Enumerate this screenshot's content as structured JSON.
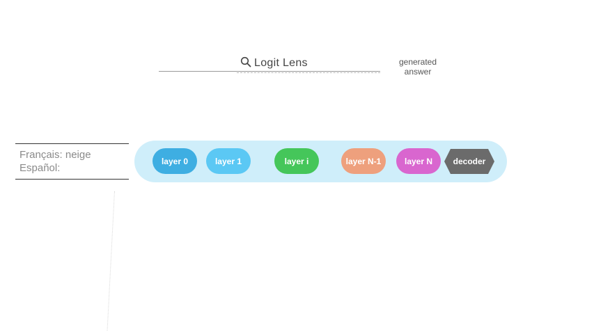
{
  "logit_lens": {
    "title": "Logit Lens",
    "icon": "search-icon"
  },
  "generated_answer": {
    "line1": "generated",
    "line2": "answer"
  },
  "prompt": {
    "line1": "Français: neige",
    "line2": "Español:"
  },
  "layers": [
    {
      "label": "layer 0",
      "color": "#3eaee2"
    },
    {
      "label": "layer 1",
      "color": "#5bc8f4"
    },
    {
      "label": "layer i",
      "color": "#45c65a"
    },
    {
      "label": "layer N-1",
      "color": "#eea07d"
    },
    {
      "label": "layer N",
      "color": "#d966cf"
    }
  ],
  "decoder": {
    "label": "decoder",
    "color": "#6b6b6b"
  },
  "colors": {
    "band": "#cfeefa"
  }
}
